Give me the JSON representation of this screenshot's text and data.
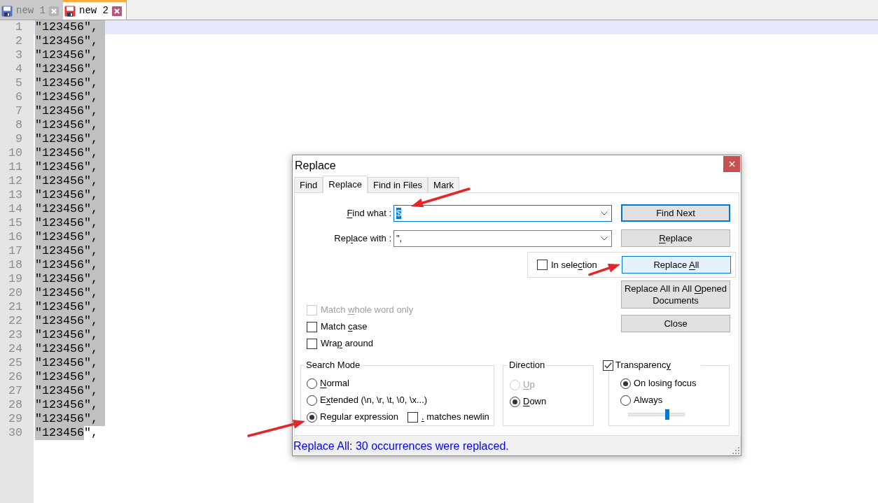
{
  "editor_tabs": [
    {
      "label": "new 1",
      "selected": false,
      "saved": true
    },
    {
      "label": "new 2",
      "selected": true,
      "saved": false
    }
  ],
  "editor": {
    "lines": [
      {
        "number": "1",
        "current": true,
        "segments": [
          {
            "text": "\"123456\",",
            "selected": true
          }
        ]
      },
      {
        "number": "2",
        "current": false,
        "segments": [
          {
            "text": "\"123456\",",
            "selected": true
          }
        ]
      },
      {
        "number": "3",
        "current": false,
        "segments": [
          {
            "text": "\"123456\",",
            "selected": true
          }
        ]
      },
      {
        "number": "4",
        "current": false,
        "segments": [
          {
            "text": "\"123456\",",
            "selected": true
          }
        ]
      },
      {
        "number": "5",
        "current": false,
        "segments": [
          {
            "text": "\"123456\",",
            "selected": true
          }
        ]
      },
      {
        "number": "6",
        "current": false,
        "segments": [
          {
            "text": "\"123456\",",
            "selected": true
          }
        ]
      },
      {
        "number": "7",
        "current": false,
        "segments": [
          {
            "text": "\"123456\",",
            "selected": true
          }
        ]
      },
      {
        "number": "8",
        "current": false,
        "segments": [
          {
            "text": "\"123456\",",
            "selected": true
          }
        ]
      },
      {
        "number": "9",
        "current": false,
        "segments": [
          {
            "text": "\"123456\",",
            "selected": true
          }
        ]
      },
      {
        "number": "10",
        "current": false,
        "segments": [
          {
            "text": "\"123456\",",
            "selected": true
          }
        ]
      },
      {
        "number": "11",
        "current": false,
        "segments": [
          {
            "text": "\"123456\",",
            "selected": true
          }
        ]
      },
      {
        "number": "12",
        "current": false,
        "segments": [
          {
            "text": "\"123456\",",
            "selected": true
          }
        ]
      },
      {
        "number": "13",
        "current": false,
        "segments": [
          {
            "text": "\"123456\",",
            "selected": true
          }
        ]
      },
      {
        "number": "14",
        "current": false,
        "segments": [
          {
            "text": "\"123456\",",
            "selected": true
          }
        ]
      },
      {
        "number": "15",
        "current": false,
        "segments": [
          {
            "text": "\"123456\",",
            "selected": true
          }
        ]
      },
      {
        "number": "16",
        "current": false,
        "segments": [
          {
            "text": "\"123456\",",
            "selected": true
          }
        ]
      },
      {
        "number": "17",
        "current": false,
        "segments": [
          {
            "text": "\"123456\",",
            "selected": true
          }
        ]
      },
      {
        "number": "18",
        "current": false,
        "segments": [
          {
            "text": "\"123456\",",
            "selected": true
          }
        ]
      },
      {
        "number": "19",
        "current": false,
        "segments": [
          {
            "text": "\"123456\",",
            "selected": true
          }
        ]
      },
      {
        "number": "20",
        "current": false,
        "segments": [
          {
            "text": "\"123456\",",
            "selected": true
          }
        ]
      },
      {
        "number": "21",
        "current": false,
        "segments": [
          {
            "text": "\"123456\",",
            "selected": true
          }
        ]
      },
      {
        "number": "22",
        "current": false,
        "segments": [
          {
            "text": "\"123456\",",
            "selected": true
          }
        ]
      },
      {
        "number": "23",
        "current": false,
        "segments": [
          {
            "text": "\"123456\",",
            "selected": true
          }
        ]
      },
      {
        "number": "24",
        "current": false,
        "segments": [
          {
            "text": "\"123456\",",
            "selected": true
          }
        ]
      },
      {
        "number": "25",
        "current": false,
        "segments": [
          {
            "text": "\"123456\",",
            "selected": true
          }
        ]
      },
      {
        "number": "26",
        "current": false,
        "segments": [
          {
            "text": "\"123456\",",
            "selected": true
          }
        ]
      },
      {
        "number": "27",
        "current": false,
        "segments": [
          {
            "text": "\"123456\",",
            "selected": true
          }
        ]
      },
      {
        "number": "28",
        "current": false,
        "segments": [
          {
            "text": "\"123456\",",
            "selected": true
          }
        ]
      },
      {
        "number": "29",
        "current": false,
        "segments": [
          {
            "text": "\"123456\",",
            "selected": true
          }
        ]
      },
      {
        "number": "30",
        "current": false,
        "segments": [
          {
            "text": "\"123456",
            "selected": true
          },
          {
            "text": "\",",
            "selected": false
          }
        ]
      }
    ]
  },
  "dialog": {
    "title": "Replace",
    "tabs": [
      {
        "label": "Find",
        "selected": false
      },
      {
        "label": "Replace",
        "selected": true
      },
      {
        "label": "Find in Files",
        "selected": false
      },
      {
        "label": "Mark",
        "selected": false
      }
    ],
    "fields": [
      {
        "label": {
          "key": "F",
          "after": "ind what :"
        },
        "value": "$",
        "focused": true,
        "value_selected": true
      },
      {
        "label": {
          "before": "Rep",
          "key": "l",
          "after": "ace with :"
        },
        "value": "\",",
        "focused": false,
        "value_selected": false
      }
    ],
    "buttons": [
      {
        "label": "Find Next",
        "default": true,
        "hovered": false
      },
      {
        "label": {
          "key": "R",
          "after": "eplace"
        },
        "default": false,
        "hovered": false
      }
    ],
    "in_selection": {
      "label": {
        "before": "In sele",
        "key": "c",
        "after": "tion"
      },
      "checked": false
    },
    "replace_all_button": {
      "label": {
        "before": "Replace ",
        "key": "A",
        "after": "ll"
      },
      "default": false,
      "hovered": true
    },
    "more_buttons": [
      {
        "label": {
          "before": "Replace All in All ",
          "key": "O",
          "after": "pened Documents"
        },
        "default": false,
        "hovered": false
      },
      {
        "label": "Close",
        "default": false,
        "hovered": false
      }
    ],
    "options": [
      {
        "label": {
          "before": "Match ",
          "key": "w",
          "after": "hole word only"
        },
        "checked": false,
        "disabled": true
      },
      {
        "label": {
          "before": "Match ",
          "key": "c",
          "after": "ase"
        },
        "checked": false,
        "disabled": false
      },
      {
        "label": {
          "before": "Wra",
          "key": "p",
          "after": " around"
        },
        "checked": false,
        "disabled": false
      }
    ],
    "search_mode": {
      "title": "Search Mode",
      "options": [
        {
          "label": {
            "key": "N",
            "after": "ormal"
          },
          "selected": false
        },
        {
          "label": {
            "before": "E",
            "key": "x",
            "after": "tended (\\n, \\r, \\t, \\0, \\x...)"
          },
          "selected": false
        },
        {
          "label": {
            "before": "Re",
            "key": "g",
            "after": "ular expression"
          },
          "selected": true
        }
      ],
      "dot_matches_newline": {
        "label": {
          "key": ".",
          "after": " matches newlin"
        },
        "checked": false
      }
    },
    "direction": {
      "title": "Direction",
      "options": [
        {
          "label": {
            "key": "U",
            "after": "p"
          },
          "selected": false,
          "disabled": true
        },
        {
          "label": {
            "key": "D",
            "after": "own"
          },
          "selected": true,
          "disabled": false
        }
      ]
    },
    "transparency": {
      "label": {
        "before": "Transparenc",
        "key": "y"
      },
      "checked": true,
      "options": [
        {
          "label": "On losing focus",
          "selected": true
        },
        {
          "label": "Always",
          "selected": false
        }
      ],
      "slider": {
        "level": 0.69
      }
    },
    "status": "Replace All: 30 occurrences were replaced."
  }
}
